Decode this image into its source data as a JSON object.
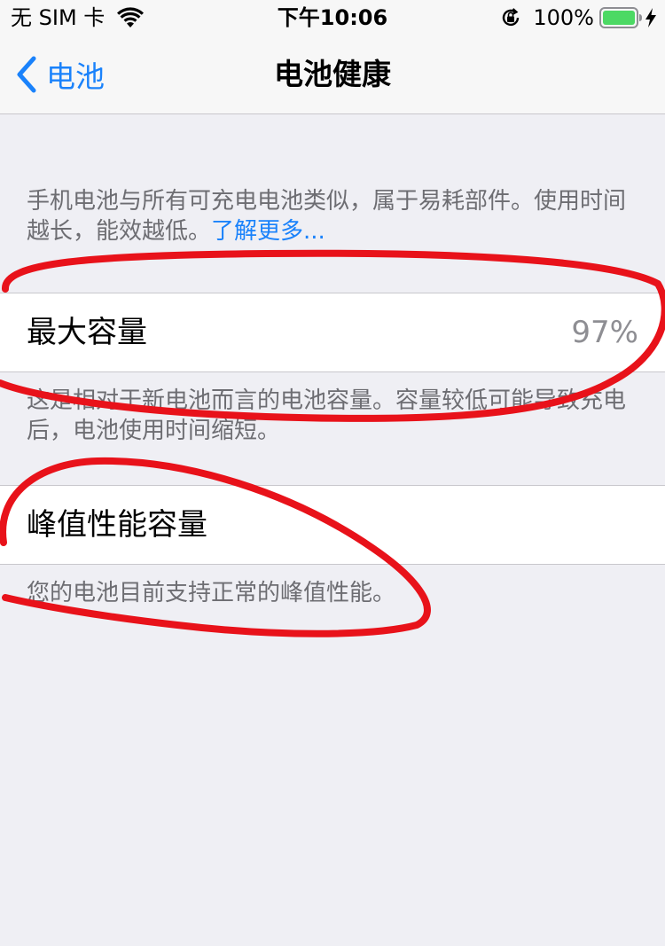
{
  "status_bar": {
    "carrier": "无 SIM 卡",
    "time": "下午10:06",
    "battery_percent": "100%",
    "icons": [
      "wifi-icon",
      "rotation-lock-icon",
      "battery-icon",
      "charging-bolt-icon"
    ]
  },
  "nav": {
    "back_label": "电池",
    "title": "电池健康"
  },
  "intro": {
    "text": "手机电池与所有可充电电池类似，属于易耗部件。使用时间越长，能效越低。",
    "link_label": "了解更多..."
  },
  "max_capacity": {
    "label": "最大容量",
    "value": "97%",
    "footnote": "这是相对于新电池而言的电池容量。容量较低可能导致充电后，电池使用时间缩短。"
  },
  "peak_performance": {
    "label": "峰值性能容量",
    "footnote": "您的电池目前支持正常的峰值性能。"
  },
  "colors": {
    "accent": "#1a82fb",
    "background": "#efeff4",
    "annotation": "#e8121a",
    "battery_fill": "#4cd964"
  }
}
